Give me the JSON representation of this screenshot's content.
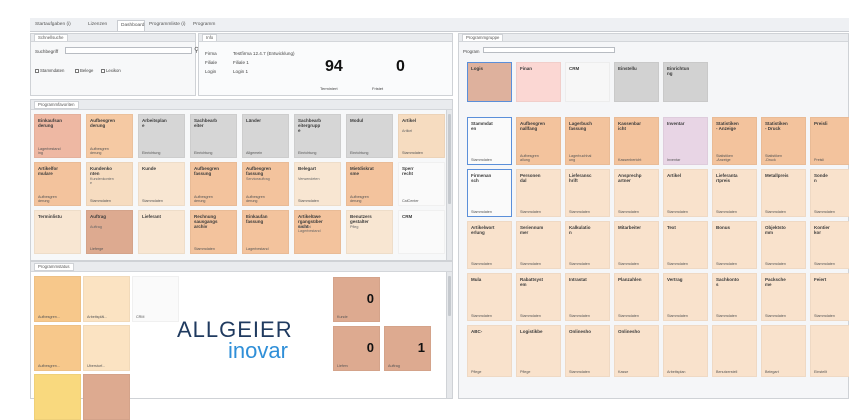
{
  "tabs": [
    {
      "label": "Startaufgaben (i)",
      "active": false
    },
    {
      "label": "Lizenzen",
      "active": false
    },
    {
      "label": "Dashboard",
      "active": true
    },
    {
      "label": "Programmliste (i)",
      "active": false
    },
    {
      "label": "Programm",
      "active": false
    }
  ],
  "search_panel": {
    "title": "Schnellsuche",
    "label": "Suchbegriff",
    "value": "",
    "options": [
      "Stammdaten",
      "Belege",
      "Lexikon"
    ]
  },
  "info_panel": {
    "title": "Info",
    "rows": [
      {
        "label": "Firma",
        "value": "Testfirma 12.4.7 (Entwicklung)"
      },
      {
        "label": "Filiale",
        "value": "Filiale 1"
      },
      {
        "label": "Login",
        "value": "Login 1"
      }
    ],
    "counters": [
      {
        "value": "94",
        "label": "Terminiert"
      },
      {
        "value": "0",
        "label": "Fristet"
      }
    ]
  },
  "favorites_panel": {
    "title": "Programmfavoriten",
    "tiles": [
      {
        "title": "Einkaufsan\nderung",
        "sub": "",
        "bottom": "Lagerbestand\ning",
        "color": "#eeb8a3"
      },
      {
        "title": "Aufbesgren\nderung",
        "sub": "",
        "bottom": "Aufbesgren\nderung",
        "color": "#f5c9a3"
      },
      {
        "title": "Arbeitsplan\ne",
        "sub": "",
        "bottom": "Einrichtung",
        "color": "#d6d6d6"
      },
      {
        "title": "Sachbearb\neiter",
        "sub": "",
        "bottom": "Einrichtung",
        "color": "#d6d6d6"
      },
      {
        "title": "Länder",
        "sub": "",
        "bottom": "Allgemein",
        "color": "#d6d6d6"
      },
      {
        "title": "Sachbearb\neitergrupp\ne",
        "sub": "",
        "bottom": "Einrichtung",
        "color": "#d6d6d6"
      },
      {
        "title": "Modul",
        "sub": "",
        "bottom": "Einrichtung",
        "color": "#d6d6d6"
      },
      {
        "title": "Artikel",
        "sub": "Artikel",
        "bottom": "Stammdaten",
        "color": "#f6dcc0"
      },
      {
        "title": "Artikelfor\nmulare",
        "sub": "",
        "bottom": "Aufbesgren\nderung",
        "color": "#f3c39d"
      },
      {
        "title": "Kundenko\nnten",
        "sub": "Kundenkonten\ne",
        "bottom": "Stammdaten",
        "color": "#f6dcc0"
      },
      {
        "title": "Kunde",
        "sub": "",
        "bottom": "Stammdaten",
        "color": "#f8e6d2"
      },
      {
        "title": "Aufbesgren\nfassung",
        "sub": "",
        "bottom": "Aufbesgren\nderung",
        "color": "#f3c39d"
      },
      {
        "title": "Aufbesgren\nfassung",
        "sub": "Serviceauftrag",
        "bottom": "Aufbesgren\nderung",
        "color": "#f3c39d"
      },
      {
        "title": "Belegart",
        "sub": "Verwendeten",
        "bottom": "Stammdaten",
        "color": "#f8e6d2"
      },
      {
        "title": "Mietdiskrat\nsme",
        "sub": "",
        "bottom": "Aufbesgren\nderung",
        "color": "#f3c39d"
      },
      {
        "title": "Sperr\nrecht",
        "sub": "",
        "bottom": "CalCenter",
        "color": "#fafafa"
      },
      {
        "title": "Terminlistu",
        "sub": "",
        "bottom": "",
        "color": "#f8e6d2"
      },
      {
        "title": "Auftrag",
        "sub": "Auftrag",
        "bottom": "Lieferge",
        "color": "#ddaa90"
      },
      {
        "title": "Lieferant",
        "sub": "",
        "bottom": "",
        "color": "#f8e6d2"
      },
      {
        "title": "Rechnung\nsausgangs\narchiv",
        "sub": "",
        "bottom": "Stammdaten",
        "color": "#f3c39d"
      },
      {
        "title": "Einkaufan\nfassung",
        "sub": "",
        "bottom": "Lagerbestand",
        "color": "#f3c39d"
      },
      {
        "title": "Artikelüwe\nrgangsüber\nsicht",
        "sub": "Besuchl\nLagerbestand",
        "bottom": "",
        "color": "#f3c39d"
      },
      {
        "title": "Benutzers\ngestalter",
        "sub": "Pfleg",
        "bottom": "",
        "color": "#f8e6d2"
      },
      {
        "title": "CRM",
        "sub": "",
        "bottom": "",
        "color": "#fafafa"
      }
    ]
  },
  "status_panel": {
    "title": "Programmstatus",
    "tiles": [
      {
        "label": "Aufbesgren...",
        "color": "#f7c88b"
      },
      {
        "label": "Arbeitspläl...",
        "color": "#fbe3c2"
      },
      {
        "label": "CRM",
        "color": "#fafafa"
      },
      {
        "label": "Aufbesgren...",
        "color": "#f7c88b"
      },
      {
        "label": "Ubersturf...",
        "color": "#fbe3c2"
      },
      {
        "label": "",
        "color": "#f9d97e"
      },
      {
        "label": "",
        "color": "#ddaa90"
      }
    ],
    "counters": [
      {
        "value": "0",
        "label": "Kunde"
      },
      {
        "value": "0",
        "label": "Lieferv"
      },
      {
        "value": "1",
        "label": "Auftrag"
      }
    ],
    "logo": {
      "line1": "ALLGEIER",
      "line2": "inovar"
    }
  },
  "program_panel": {
    "title": "Programmgruppe",
    "search_label": "Program",
    "search_value": "",
    "groups": [
      {
        "title": "Logis",
        "color": "#deb19d",
        "selected": true
      },
      {
        "title": "Finan",
        "color": "#fbd7d3",
        "selected": false
      },
      {
        "title": "CRM",
        "color": "#f7f7f7",
        "selected": false
      },
      {
        "title": "Einstellu",
        "color": "#d2d2d2",
        "selected": false
      },
      {
        "title": "Einrichtun\nng",
        "color": "#d2d2d2",
        "selected": false
      }
    ],
    "tiles": [
      {
        "title": "Stammdat\nen",
        "bottom": "Stammdaten",
        "color": "#fafafa",
        "selected": true
      },
      {
        "title": "Aufbesgren\nnallfang",
        "bottom": "Aufbesgren\nallung",
        "color": "#f3c39d"
      },
      {
        "title": "Lagerbuch\nfassung",
        "bottom": "Lagerbuchhal\nung",
        "color": "#f3c39d"
      },
      {
        "title": "Kassenbar\nicht",
        "bottom": "Kassenbericht",
        "color": "#f3c39d"
      },
      {
        "title": "Inventar",
        "bottom": "Inventar",
        "color": "#e8d5e5"
      },
      {
        "title": "Statistiken\n- Anzeige",
        "bottom": "Statistiken\n-Anzeige",
        "color": "#f3c39d"
      },
      {
        "title": "Statistiken\n- Druck",
        "bottom": "Statistiken\n-Druck",
        "color": "#f3c39d"
      },
      {
        "title": "Preisli",
        "bottom": "Preisli",
        "color": "#f3c39d"
      },
      {
        "title": "Firmenan\nsch",
        "bottom": "Stammdaten",
        "color": "#fafafa",
        "selected": true
      },
      {
        "title": "Personen\ndal",
        "bottom": "Stammdaten",
        "color": "#f9e2cc"
      },
      {
        "title": "Lieferansc\nhrift",
        "bottom": "Stammdaten",
        "color": "#f9e2cc"
      },
      {
        "title": "Ansprechp\nartner",
        "bottom": "Stammdaten",
        "color": "#f9e2cc"
      },
      {
        "title": "Artikel",
        "bottom": "Stammdaten",
        "color": "#f9e2cc"
      },
      {
        "title": "Lieferanta\nrtpreis",
        "bottom": "Stammdaten",
        "color": "#f9e2cc"
      },
      {
        "title": "Metallpreis",
        "bottom": "Stammdaten",
        "color": "#f9e2cc"
      },
      {
        "title": "Sonde\nn",
        "bottom": "Stammdaten",
        "color": "#f9e2cc"
      },
      {
        "title": "Artikelwort\nerlung",
        "bottom": "Stammdaten",
        "color": "#f9e2cc"
      },
      {
        "title": "Seriennum\nmer",
        "bottom": "Stammdaten",
        "color": "#f9e2cc"
      },
      {
        "title": "Kalkulatio\nn",
        "bottom": "Stammdaten",
        "color": "#f9e2cc"
      },
      {
        "title": "Mitarbeiter",
        "bottom": "Stammdaten",
        "color": "#f9e2cc"
      },
      {
        "title": "Text",
        "bottom": "Stammdaten",
        "color": "#f9e2cc"
      },
      {
        "title": "Bonus",
        "bottom": "Stammdaten",
        "color": "#f9e2cc"
      },
      {
        "title": "Objektsto\nmm",
        "bottom": "Stammdaten",
        "color": "#f9e2cc"
      },
      {
        "title": "Kontier\nkor",
        "bottom": "Stammdaten",
        "color": "#f9e2cc"
      },
      {
        "title": "Mula",
        "bottom": "Stammdaten",
        "color": "#f9e2cc"
      },
      {
        "title": "Rabattsyst\nem",
        "bottom": "Stammdaten",
        "color": "#f9e2cc"
      },
      {
        "title": "Intrastat",
        "bottom": "Stammdaten",
        "color": "#f9e2cc"
      },
      {
        "title": "Planzahlen",
        "bottom": "Stammdaten",
        "color": "#f9e2cc"
      },
      {
        "title": "Vertrag",
        "bottom": "Stammdaten",
        "color": "#f9e2cc"
      },
      {
        "title": "Sachkonto\ns",
        "bottom": "Stammdaten",
        "color": "#f9e2cc"
      },
      {
        "title": "Packsche\nme",
        "bottom": "Stammdaten",
        "color": "#f9e2cc"
      },
      {
        "title": "Feiert",
        "bottom": "Stammdaten",
        "color": "#f9e2cc"
      },
      {
        "title": "ABC-",
        "bottom": "Pflege",
        "color": "#f9e2cc"
      },
      {
        "title": "Logistikbe",
        "bottom": "Pflege",
        "color": "#f9e2cc"
      },
      {
        "title": "Onlinesho",
        "bottom": "Stammdaten",
        "color": "#f9e2cc"
      },
      {
        "title": "Onlinesho",
        "bottom": "Kasse",
        "color": "#f9e2cc"
      },
      {
        "title": "",
        "bottom": "Arbeitsplan",
        "color": "#f9e2cc"
      },
      {
        "title": "",
        "bottom": "Benutzerstell",
        "color": "#f9e2cc"
      },
      {
        "title": "",
        "bottom": "Belegart",
        "color": "#f9e2cc"
      },
      {
        "title": "",
        "bottom": "Einstellt",
        "color": "#f9e2cc"
      }
    ]
  }
}
